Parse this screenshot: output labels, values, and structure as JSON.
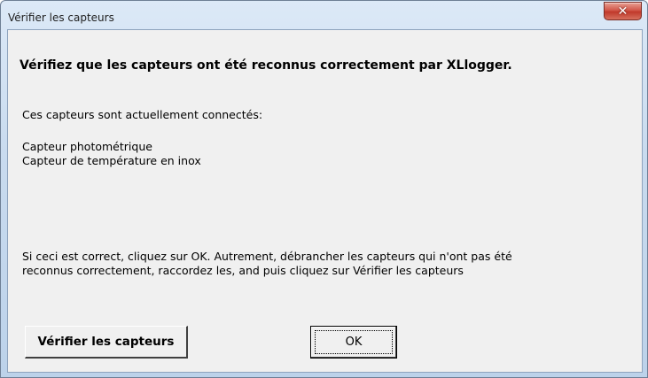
{
  "window": {
    "title": "Vérifier les capteurs"
  },
  "dialog": {
    "heading": "Vérifiez que les capteurs ont été reconnus correctement par XLlogger.",
    "connected_label": "Ces capteurs sont actuellement connectés:",
    "sensors": [
      "Capteur photométrique",
      "Capteur de température en inox"
    ],
    "instructions_line1": "Si ceci est correct, cliquez sur OK.  Autrement, débrancher les capteurs qui n'ont pas été",
    "instructions_line2": "reconnus correctement, raccordez les, and puis cliquez sur Vérifier les capteurs"
  },
  "buttons": {
    "check_label": "Vérifier les capteurs",
    "ok_label": "OK"
  },
  "icons": {
    "close": "close-icon"
  },
  "colors": {
    "titlebar": "#c9dbef",
    "close_button": "#c0392b",
    "client_background": "#f0f0f0"
  }
}
